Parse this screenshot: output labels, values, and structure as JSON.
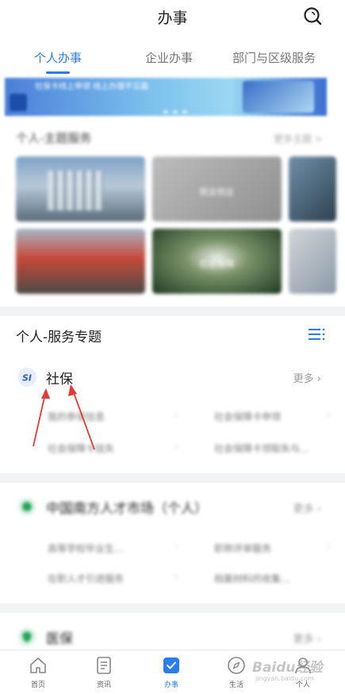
{
  "header": {
    "title": "办事"
  },
  "tabs": [
    {
      "label": "个人办事",
      "active": true
    },
    {
      "label": "企业办事",
      "active": false
    },
    {
      "label": "部门与区级服务",
      "active": false
    }
  ],
  "banner": {
    "text": "社保卡线上申领 线上办理不见面"
  },
  "theme_section": {
    "title": "个人-主题服务",
    "more": "更多主题 >"
  },
  "theme_tiles": [
    {
      "caption": ""
    },
    {
      "caption": "就业创业"
    },
    {
      "caption": ""
    },
    {
      "caption": ""
    },
    {
      "caption": "社会保障"
    },
    {
      "caption": ""
    }
  ],
  "service_section": {
    "title": "个人-服务专题"
  },
  "cards": [
    {
      "name": "社保",
      "more": "更多",
      "items": [
        "我的参保信息",
        "社会保障卡申领",
        "社会保障卡挂失",
        "社会保障卡领取失与..."
      ]
    },
    {
      "name": "中国南方人才市场（个人）",
      "more": "更多",
      "items": [
        "高等学校毕业生...",
        "职称评审服务",
        "在职人才引进服务",
        "档案材料的收集..."
      ]
    },
    {
      "name": "医保",
      "more": "更多"
    }
  ],
  "bottom_nav": [
    {
      "label": "首页",
      "icon": "home-icon",
      "active": false
    },
    {
      "label": "资讯",
      "icon": "news-icon",
      "active": false
    },
    {
      "label": "办事",
      "icon": "checkbox-icon",
      "active": true
    },
    {
      "label": "生活",
      "icon": "compass-icon",
      "active": false
    },
    {
      "label": "个人",
      "icon": "person-icon",
      "active": false
    }
  ],
  "watermark": {
    "text": "Baidu经验",
    "sub": "jingyan.baidu.com"
  },
  "colors": {
    "accent": "#2b7de9",
    "arrow": "#e53935"
  }
}
